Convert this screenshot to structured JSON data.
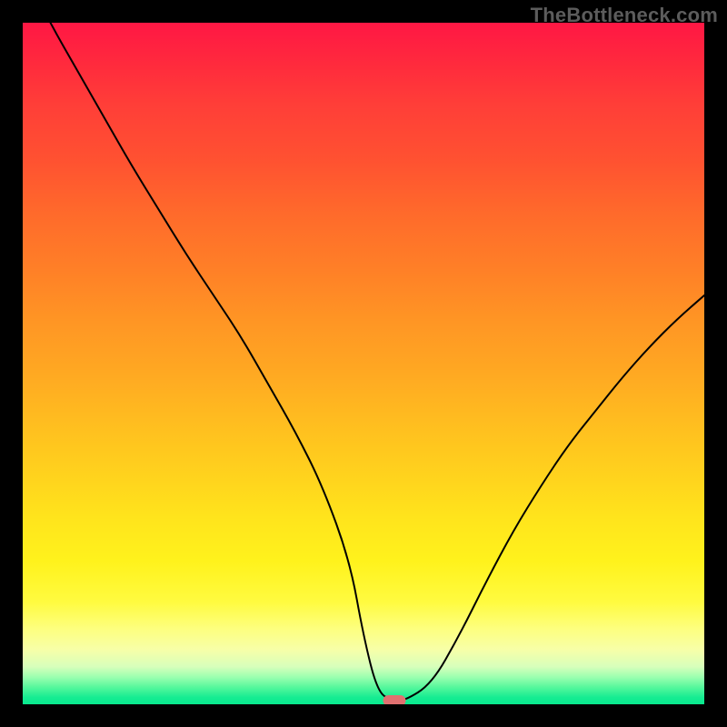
{
  "watermark": "TheBottleneck.com",
  "chart_data": {
    "type": "line",
    "title": "",
    "xlabel": "",
    "ylabel": "",
    "xlim": [
      0,
      100
    ],
    "ylim": [
      0,
      100
    ],
    "grid": false,
    "legend": false,
    "series": [
      {
        "name": "bottleneck-curve",
        "color": "#000000",
        "x": [
          0,
          4,
          8,
          12,
          16,
          20,
          24,
          28,
          32,
          36,
          40,
          44,
          48,
          50,
          52,
          54,
          56,
          60,
          64,
          68,
          72,
          76,
          80,
          84,
          88,
          92,
          96,
          100
        ],
        "y": [
          108,
          100,
          93,
          86,
          79,
          72.5,
          66,
          60,
          54,
          47,
          40,
          32,
          21,
          10,
          2,
          0.5,
          0.5,
          3,
          10,
          18,
          25.5,
          32,
          38,
          43,
          48,
          52.5,
          56.5,
          60
        ]
      }
    ],
    "marker": {
      "x": 54.5,
      "y": 0.5,
      "color": "#e07070"
    },
    "background": {
      "type": "vertical-gradient",
      "stops": [
        {
          "pos": 0,
          "color": "#ff1744"
        },
        {
          "pos": 25,
          "color": "#ff6a2b"
        },
        {
          "pos": 50,
          "color": "#ffaa22"
        },
        {
          "pos": 75,
          "color": "#fff21c"
        },
        {
          "pos": 92,
          "color": "#f7ffa8"
        },
        {
          "pos": 100,
          "color": "#08e98e"
        }
      ]
    }
  }
}
